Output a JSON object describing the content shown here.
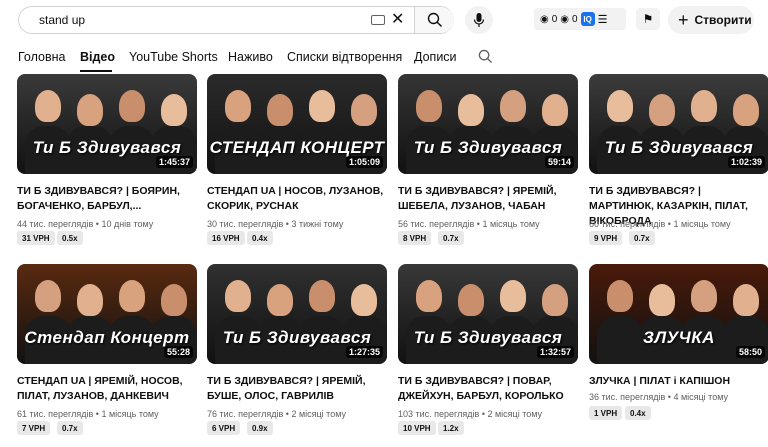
{
  "search": {
    "value": "stand up"
  },
  "extension": {
    "count_a": "0",
    "count_b": "0",
    "badge": "IQ"
  },
  "create_label": "Створити",
  "tabs": [
    "Головна",
    "Відео",
    "YouTube Shorts",
    "Наживо",
    "Списки відтворення",
    "Дописи"
  ],
  "active_tab": "Відео",
  "videos": [
    {
      "title": "ТИ Б ЗДИВУВАВСЯ? | БОЯРИН, БОГАЧЕНКО, БАРБУЛ,...",
      "views": "44 тис. переглядів",
      "age": "10 днів тому",
      "duration": "1:45:37",
      "vph": "31 VPH",
      "ratio": "0.5x",
      "thumb_text": "Ти Б Здивувався",
      "thumb_bg": "#3a3a3a"
    },
    {
      "title": "СТЕНДАП UA | НОСОВ, ЛУЗАНОВ, СКОРИК, РУСНАК",
      "views": "30 тис. переглядів",
      "age": "3 тижні тому",
      "duration": "1:05:09",
      "vph": "16 VPH",
      "ratio": "0.4x",
      "thumb_text": "СТЕНДАП КОНЦЕРТ",
      "thumb_bg": "#2b2b2b"
    },
    {
      "title": "ТИ Б ЗДИВУВАВСЯ? | ЯРЕМІЙ, ШЕБЕЛА, ЛУЗАНОВ, ЧАБАН",
      "views": "56 тис. переглядів",
      "age": "1 місяць тому",
      "duration": "59:14",
      "vph": "8 VPH",
      "ratio": "0.7x",
      "thumb_text": "Ти Б Здивувався",
      "thumb_bg": "#353535"
    },
    {
      "title": "ТИ Б ЗДИВУВАВСЯ? | МАРТИНЮК, КАЗАРКІН, ПІЛАТ, ВІКОБРОДА",
      "views": "60 тис. переглядів",
      "age": "1 місяць тому",
      "duration": "1:02:39",
      "vph": "9 VPH",
      "ratio": "0.7x",
      "thumb_text": "Ти Б Здивувався",
      "thumb_bg": "#3c3c3c"
    },
    {
      "title": "СТЕНДАП UA | ЯРЕМІЙ, НОСОВ, ПІЛАТ, ЛУЗАНОВ, ДАНКЕВИЧ",
      "views": "61 тис. переглядів",
      "age": "1 місяць тому",
      "duration": "55:28",
      "vph": "7 VPH",
      "ratio": "0.7x",
      "thumb_text": "Стендап Концерт",
      "thumb_bg": "#5a2a10"
    },
    {
      "title": "ТИ Б ЗДИВУВАВСЯ? | ЯРЕМІЙ, БУШЕ, ОЛОС, ГАВРИЛІВ",
      "views": "76 тис. переглядів",
      "age": "2 місяці тому",
      "duration": "1:27:35",
      "vph": "6 VPH",
      "ratio": "0.9x",
      "thumb_text": "Ти Б Здивувався",
      "thumb_bg": "#303030"
    },
    {
      "title": "ТИ Б ЗДИВУВАВСЯ? | ПОВАР, ДЖЕЙХУН, БАРБУЛ, КОРОЛЬКО",
      "views": "103 тис. переглядів",
      "age": "2 місяці тому",
      "duration": "1:32:57",
      "vph": "10 VPH",
      "ratio": "1.2x",
      "thumb_text": "Ти Б Здивувався",
      "thumb_bg": "#383838"
    },
    {
      "title": "ЗЛУЧКА | ПІЛАТ і КАПІШОН",
      "views": "36 тис. переглядів",
      "age": "4 місяці тому",
      "duration": "58:50",
      "vph": "1 VPH",
      "ratio": "0.4x",
      "thumb_text": "ЗЛУЧКА",
      "thumb_bg": "#4a1a0a"
    }
  ]
}
